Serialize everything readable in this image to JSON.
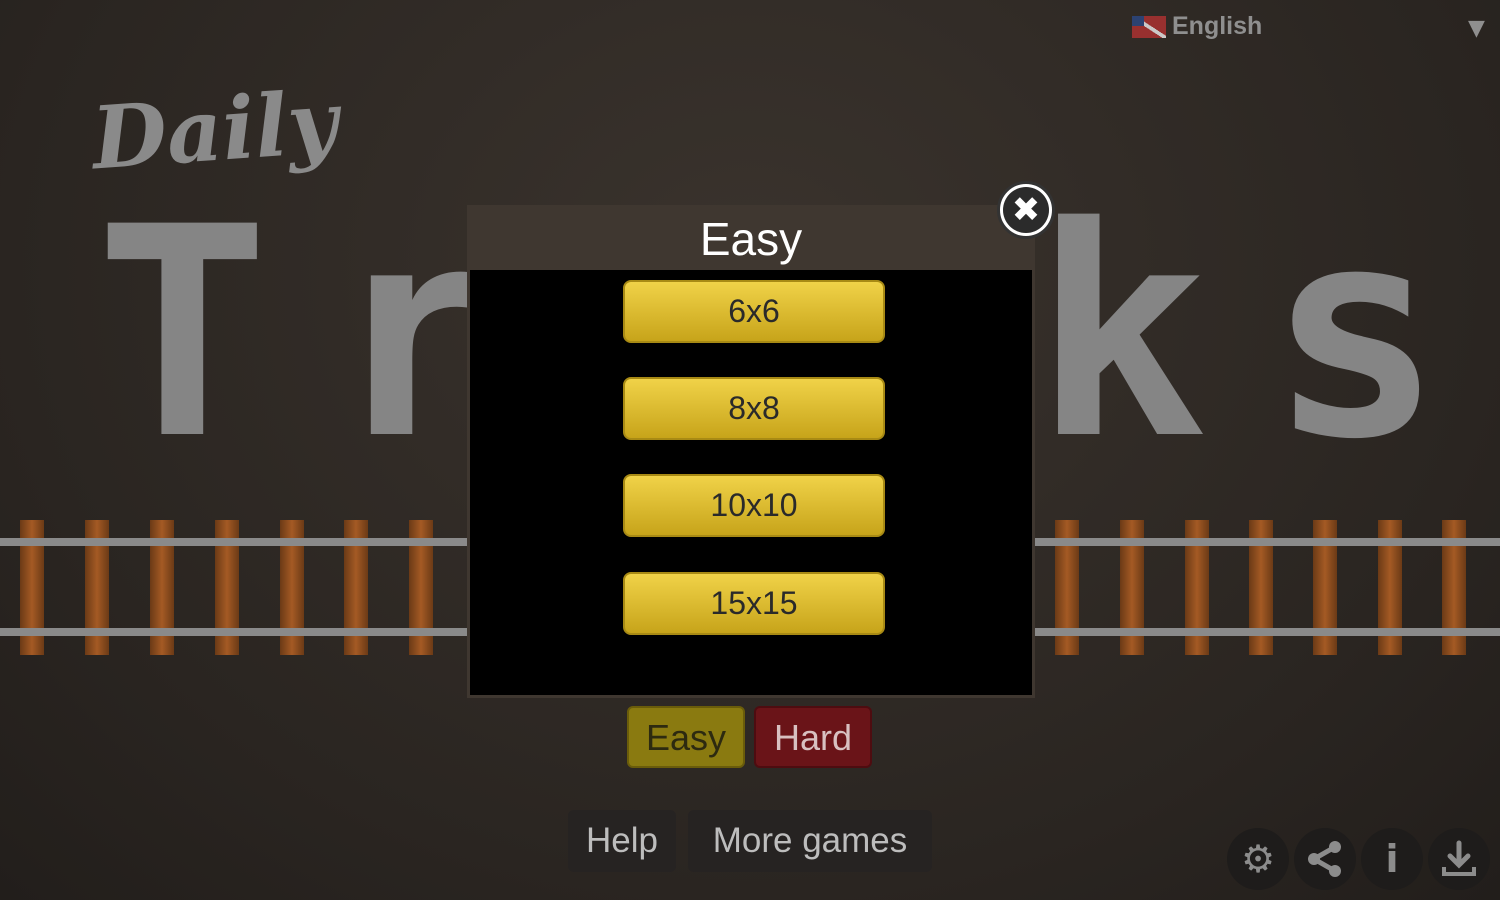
{
  "language": {
    "label": "English",
    "flag": "uk-flag-icon",
    "arrow": "▼"
  },
  "logo": {
    "line1": "Daily",
    "line2": "Tracks"
  },
  "modal": {
    "title": "Easy",
    "close": "✖",
    "sizes": [
      "6x6",
      "8x8",
      "10x10",
      "15x15"
    ]
  },
  "difficulty": {
    "easy": "Easy",
    "hard": "Hard"
  },
  "nav": {
    "help": "Help",
    "more_games": "More games"
  },
  "toolbar": {
    "settings": "⚙",
    "share": "share",
    "info": "i",
    "download": "⤓"
  },
  "colors": {
    "button_gold": "#e2c232",
    "hard_red": "#6a1418",
    "modal_header": "#3f3730"
  }
}
